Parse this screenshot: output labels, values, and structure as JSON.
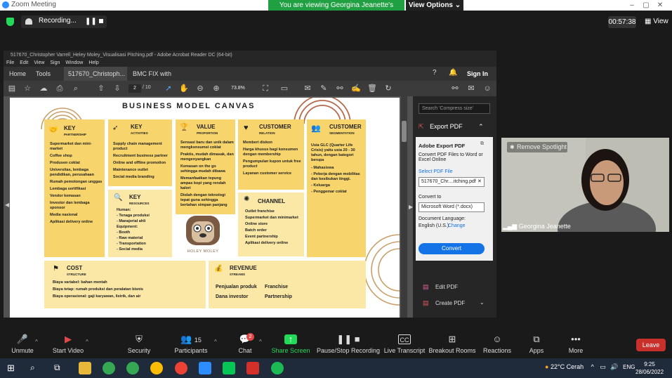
{
  "zoom": {
    "window_title": "Zoom Meeting",
    "banner": "You are viewing Georgina Jeanette's screen",
    "view_options": "View Options",
    "recording_label": "Recording...",
    "timer": "00:57:38",
    "view_label": "View"
  },
  "acrobat": {
    "title": "517670_Christopher Varrell_Heley Moley_Visualisasi Pitching.pdf - Adobe Acrobat Reader DC (64-bit)",
    "menu": [
      "File",
      "Edit",
      "View",
      "Sign",
      "Window",
      "Help"
    ],
    "tabs": [
      "Home",
      "Tools",
      "517670_Christoph...",
      "BMC FIX with com..."
    ],
    "sign_in": "Sign In",
    "page_current": "2",
    "page_total": "/ 10",
    "zoom_level": "73.8%",
    "right_pane": {
      "search_placeholder": "Search 'Compress size'",
      "export_pdf": "Export PDF",
      "panel_title": "Adobe Export PDF",
      "panel_desc": "Convert PDF Files to Word or Excel Online",
      "select_file_label": "Select PDF File",
      "selected_file": "517670_Chr....itching.pdf",
      "convert_to_label": "Convert to",
      "convert_to_value": "Microsoft Word (*.docx)",
      "doc_lang_label": "Document Language:",
      "doc_lang_value": "English (U.S.)",
      "change_link": "Change",
      "convert_button": "Convert",
      "edit_pdf": "Edit PDF",
      "create_pdf": "Create PDF"
    }
  },
  "canvas": {
    "title": "BUSINESS MODEL CANVAS",
    "key_partnership": {
      "head": "KEY",
      "sub": "PARTNERSHIP",
      "items": [
        "Supermarket dan mini-market",
        "Coffee shop",
        "Produsen coklat",
        "Universitas, lembaga pendidikan, perusahaan",
        "Rumah pemotongan unggas",
        "Lembaga sertifikasi",
        "Vendor kemasan",
        "Investor dan lembaga sponsor",
        "Media nasional",
        "Aplikasi delivery online"
      ]
    },
    "key_activities": {
      "head": "KEY",
      "sub": "ACTIVITIES",
      "items": [
        "Supply chain management product",
        "Recruitment business partner",
        "Online and offline promotion",
        "Maintenance outlet",
        "Social media branding"
      ]
    },
    "key_resources": {
      "head": "KEY",
      "sub": "RESOURCES",
      "items": [
        "Human:",
        "- Tenaga produksi",
        "- Manajerial ahli",
        "Equipment:",
        "- Booth",
        "- Raw material",
        "- Transportation",
        "- Social media"
      ]
    },
    "value_proposition": {
      "head": "VALUE",
      "sub": "PROPORTION",
      "items": [
        "Sensasi baru dan unik dalam mengkonsumsi coklat",
        "Praktis, mudah dimasak, dan mengenyangkan",
        "Kemasan on the go sehingga mudah dibawa",
        "Memanfaatkan tepung ampas kopi yang rendah kalori",
        "Diolah dengan teknologi tepat guna sehingga bertahan simpan panjang"
      ]
    },
    "customer_relation": {
      "head": "CUSTOMER",
      "sub": "RELATION",
      "items": [
        "Memberi diskon",
        "Harga khusus bagi konsumen dengan membership",
        "Pengumpulan kupon untuk free product",
        "Layanan customer service"
      ]
    },
    "customer_segmentation": {
      "head": "CUSTOMER",
      "sub": "SEGMENTATION",
      "items": [
        "Usia GLC (Quarter Life Crisis) yaitu usia 20 - 30 tahun, dengan kategori berupa",
        "- Mahasiswa",
        "- Pekerja dengan mobilitas dan kesibukan tinggi.",
        "- Keluarga",
        "- Penggemar coklat"
      ]
    },
    "channel": {
      "head": "CHANNEL",
      "items": [
        "Outlet franchise",
        "Supermarket dan minimarket",
        "Online store",
        "Batch order",
        "Event partnership",
        "Aplikasi delivery online"
      ]
    },
    "cost_structure": {
      "head": "COST",
      "sub": "STRUCTURE",
      "items": [
        "Biaya variabel: bahan mentah",
        "Biaya tetap: rumah produksi dan peralatan bisnis",
        "Biaya operasional: gaji karyawan, listrik, dan air"
      ]
    },
    "revenue_streams": {
      "head": "REVENUE",
      "sub": "STREAMS",
      "items": [
        "Penjualan produk",
        "Franchise",
        "Dana investor",
        "Partnership"
      ]
    },
    "logo_text": "HOLEY MOLEY"
  },
  "video": {
    "spotlight": "Remove Spotlight",
    "name": "Georgina Jeanette"
  },
  "controls": {
    "unmute": "Unmute",
    "start_video": "Start Video",
    "security": "Security",
    "participants": "Participants",
    "participants_count": "15",
    "chat": "Chat",
    "chat_badge": "2",
    "share_screen": "Share Screen",
    "pause_recording": "Pause/Stop Recording",
    "live_transcript": "Live Transcript",
    "breakout_rooms": "Breakout Rooms",
    "reactions": "Reactions",
    "apps": "Apps",
    "more": "More",
    "leave": "Leave"
  },
  "taskbar": {
    "weather": "22°C  Cerah",
    "lang": "ENG",
    "time": "9:25",
    "date": "28/06/2022"
  },
  "colors": {
    "zoom_green": "#20a042",
    "leave_red": "#c9302c",
    "canvas_yellow": "#f8d56c",
    "convert_blue": "#1473e6"
  }
}
